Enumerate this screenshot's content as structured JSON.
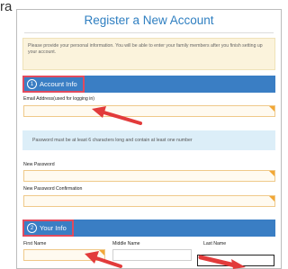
{
  "stray_text": "ra",
  "form": {
    "title": "Register a New Account",
    "info_text": "Please provide your personal information. You will be able to enter your family members after you finish setting up your account.",
    "section1": {
      "number": "1",
      "label": "Account Info"
    },
    "email_label": "Email Address(used for logging in)",
    "password_note": "Password must be at least 6 characters long and contain at least one number",
    "new_password_label": "New Password",
    "confirm_password_label": "New Password Confirmation",
    "section2": {
      "number": "2",
      "label": "Your Info"
    },
    "first_name_label": "First Name",
    "middle_name_label": "Middle Name",
    "last_name_label": "Last Name"
  },
  "colors": {
    "accent": "#3a7ec4",
    "title": "#2f7fc1",
    "highlight": "#e14a5e",
    "input_border": "#efc98a",
    "info_bg": "#fbf3dc"
  },
  "icons": [
    "number-1-icon",
    "number-2-icon",
    "red-arrow-icon"
  ]
}
